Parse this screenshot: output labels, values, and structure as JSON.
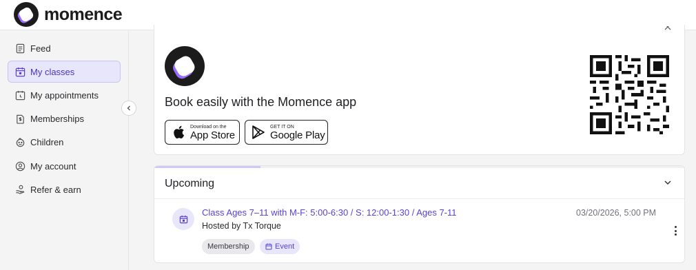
{
  "brand": {
    "name": "momence",
    "accent": "#5b3fd6"
  },
  "sidebar": {
    "items": [
      {
        "label": "Feed",
        "icon": "feed-icon",
        "active": false
      },
      {
        "label": "My classes",
        "icon": "calendar-icon",
        "active": true
      },
      {
        "label": "My appointments",
        "icon": "appointment-icon",
        "active": false
      },
      {
        "label": "Memberships",
        "icon": "membership-icon",
        "active": false
      },
      {
        "label": "Children",
        "icon": "children-icon",
        "active": false
      },
      {
        "label": "My account",
        "icon": "account-icon",
        "active": false
      },
      {
        "label": "Refer & earn",
        "icon": "refer-icon",
        "active": false
      }
    ]
  },
  "app_promo": {
    "title": "Book easily with the Momence app",
    "apple": {
      "small": "Download on the",
      "big": "App Store"
    },
    "google": {
      "small": "GET IT ON",
      "big": "Google Play"
    }
  },
  "upcoming": {
    "title": "Upcoming",
    "progress_fraction": 0.2,
    "classes": [
      {
        "title": "Class Ages 7–11 with M-F: 5:00-6:30 / S: 12:00-1:30 / Ages 7-11",
        "host": "Hosted by Tx Torque",
        "datetime": "03/20/2026, 5:00 PM",
        "tags": [
          "Membership",
          "Event"
        ]
      }
    ]
  }
}
